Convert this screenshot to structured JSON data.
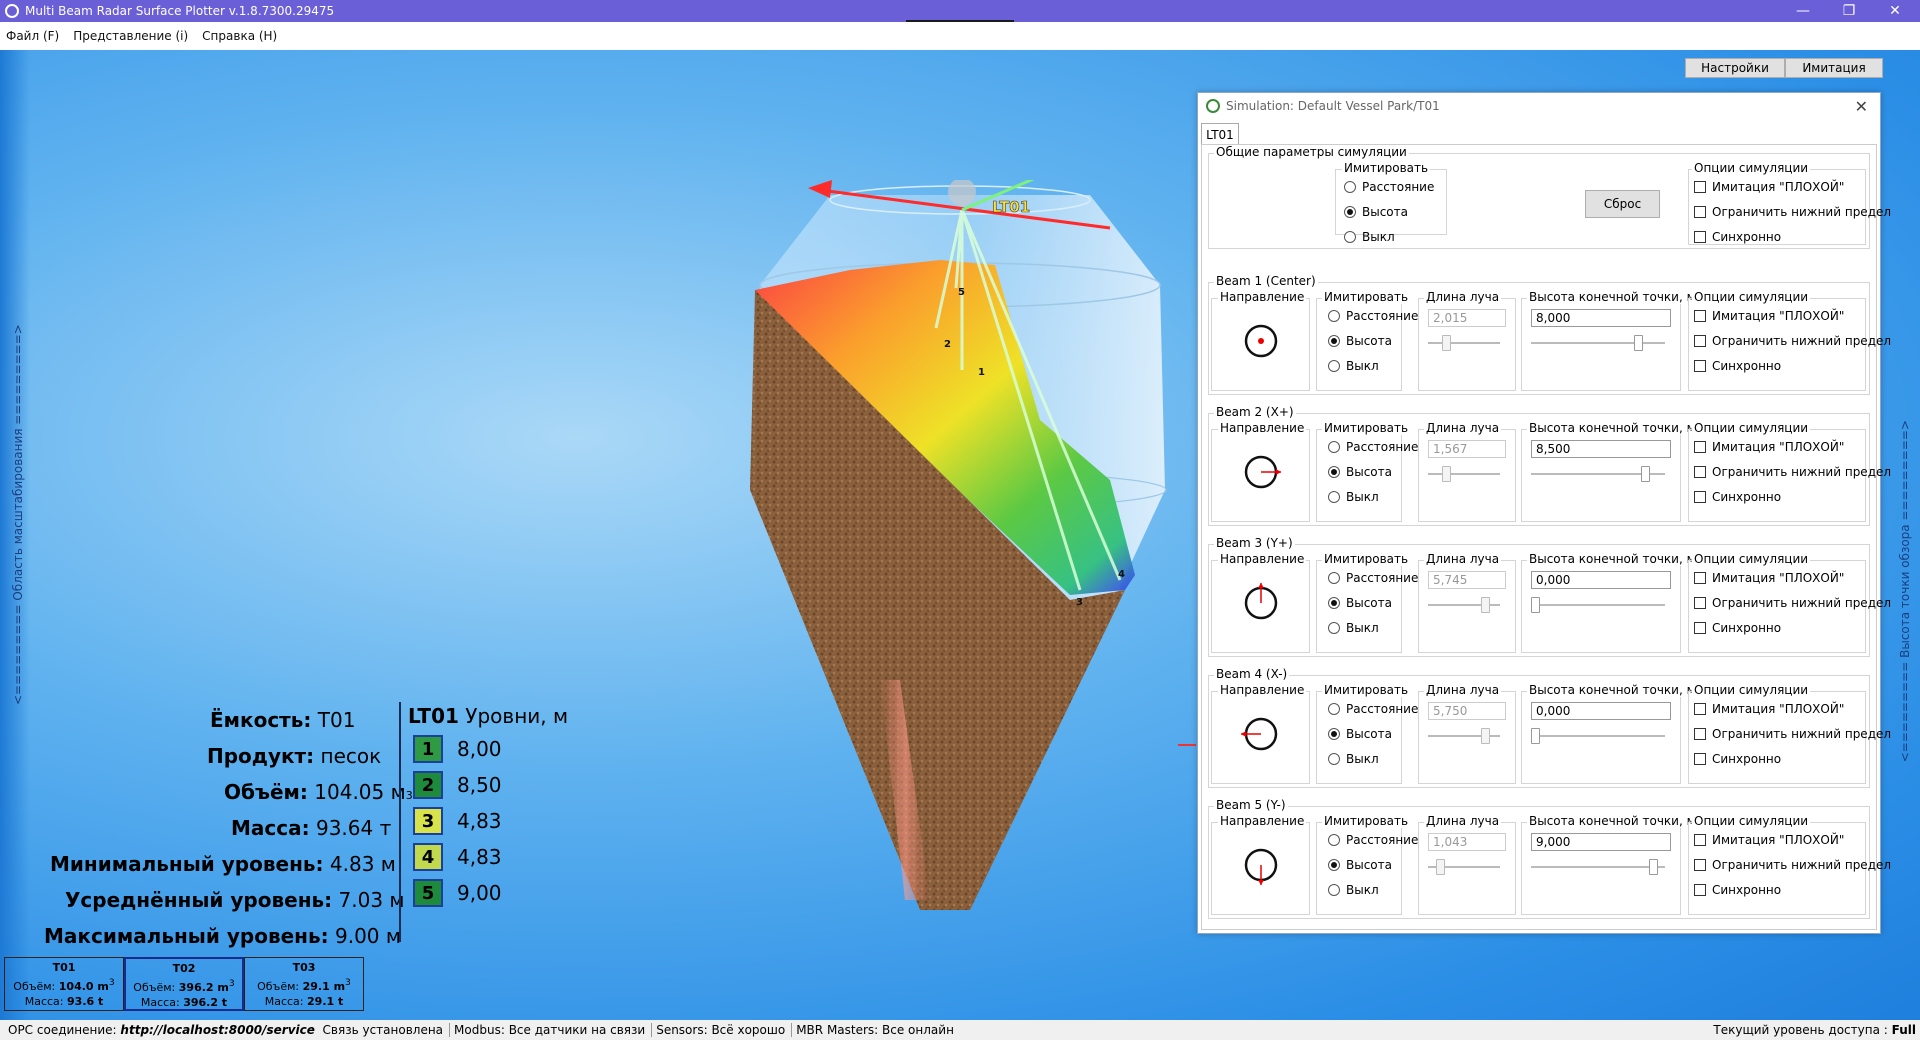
{
  "window": {
    "title": "Multi Beam Radar Surface Plotter v.1.8.7300.29475"
  },
  "menu": [
    "Файл (F)",
    "Представление (i)",
    "Справка (H)"
  ],
  "toolbar": {
    "settings": "Настройки",
    "simulation": "Имитация"
  },
  "viewport": {
    "left_label": "<========= Область масштабирования =========>",
    "right_label": "<========= Высота точки обзора =========>",
    "lt_label": "LT01",
    "beam_labels": [
      "1",
      "2",
      "3",
      "4",
      "5"
    ]
  },
  "info": {
    "capacity": {
      "label": "Ёмкость:",
      "value": "T01"
    },
    "product": {
      "label": "Продукт:",
      "value": "песок"
    },
    "volume": {
      "label": "Объём:",
      "value": "104.05 м",
      "sup": "3"
    },
    "mass": {
      "label": "Масса:",
      "value": "93.64 т"
    },
    "min_level": {
      "label": "Минимальный уровень:",
      "value": "4.83 м"
    },
    "avg_level": {
      "label": "Усреднённый уровень:",
      "value": "7.03 м"
    },
    "max_level": {
      "label": "Максимальный уровень:",
      "value": "9.00 м"
    },
    "levels_title": "LT01",
    "levels_unit": "Уровни, м",
    "levels": [
      {
        "num": "1",
        "value": "8,00",
        "color": "#2e9b44"
      },
      {
        "num": "2",
        "value": "8,50",
        "color": "#1e8a3c"
      },
      {
        "num": "3",
        "value": "4,83",
        "color": "#d8e24a"
      },
      {
        "num": "4",
        "value": "4,83",
        "color": "#c2d94e"
      },
      {
        "num": "5",
        "value": "9,00",
        "color": "#1e8a3c"
      }
    ]
  },
  "tanks": [
    {
      "name": "T01",
      "volume_label": "Объём:",
      "volume": "104.0 m",
      "mass_label": "Масса:",
      "mass": "93.6 t"
    },
    {
      "name": "T02",
      "volume_label": "Объём:",
      "volume": "396.2 m",
      "mass_label": "Масса:",
      "mass": "396.2 t"
    },
    {
      "name": "T03",
      "volume_label": "Объём:",
      "volume": "29.1 m",
      "mass_label": "Масса:",
      "mass": "29.1 t"
    }
  ],
  "status": {
    "opc_label": "OPC соединение:",
    "opc_url": "http://localhost:8000/service",
    "opc_state": "Связь установлена",
    "modbus": "Modbus: Все датчики на связи",
    "sensors": "Sensors: Всё хорошо",
    "mbr": "MBR Masters: Все онлайн",
    "access_label": "Текущий уровень доступа :",
    "access": "Full"
  },
  "sim": {
    "title": "Simulation: Default Vessel Park/T01",
    "tab": "LT01",
    "general_title": "Общие параметры симуляции",
    "imitate_label": "Имитировать",
    "options_label": "Опции симуляции",
    "reset": "Сброс",
    "radio": [
      "Расстояние",
      "Высота",
      "Выкл"
    ],
    "options": [
      "Имитация \"ПЛОХОЙ\"",
      "Ограничить нижний предел",
      "Синхронно"
    ],
    "direction_label": "Направление",
    "length_label": "Длина луча",
    "height_label": "Высота конечной точки, м",
    "beams": [
      {
        "title": "Beam 1 (Center)",
        "length": "2,015",
        "height": "8,000",
        "length_pos": 0.22,
        "height_pos": 0.82
      },
      {
        "title": "Beam 2 (X+)",
        "length": "1,567",
        "height": "8,500",
        "length_pos": 0.22,
        "height_pos": 0.88
      },
      {
        "title": "Beam 3 (Y+)",
        "length": "5,745",
        "height": "0,000",
        "length_pos": 0.84,
        "height_pos": 0.0
      },
      {
        "title": "Beam 4 (X-)",
        "length": "5,750",
        "height": "0,000",
        "length_pos": 0.84,
        "height_pos": 0.0
      },
      {
        "title": "Beam 5 (Y-)",
        "length": "1,043",
        "height": "9,000",
        "length_pos": 0.12,
        "height_pos": 0.94
      }
    ]
  }
}
